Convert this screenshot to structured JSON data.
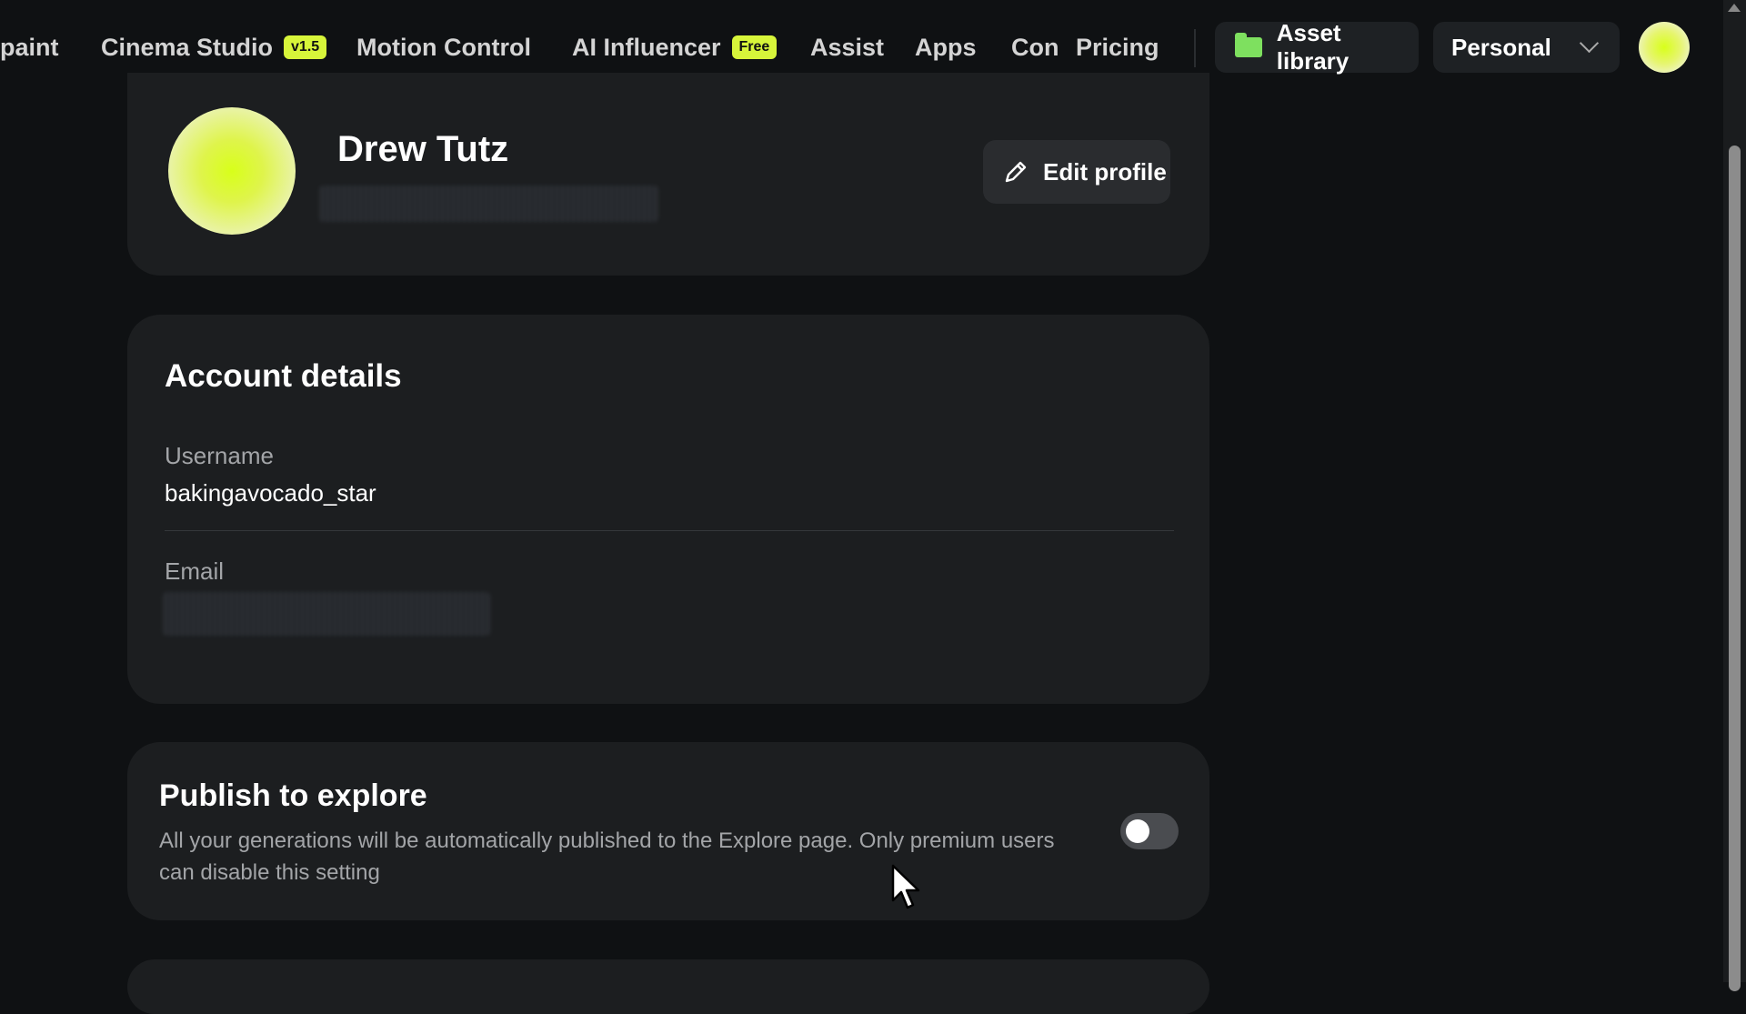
{
  "nav": {
    "items": [
      {
        "label": "paint"
      },
      {
        "label": "Cinema Studio",
        "badge": "v1.5"
      },
      {
        "label": "Motion Control"
      },
      {
        "label": "AI Influencer",
        "badge": "Free"
      },
      {
        "label": "Assist"
      },
      {
        "label": "Apps"
      },
      {
        "label": "Con"
      },
      {
        "label": "Pricing"
      }
    ],
    "asset_library": "Asset library",
    "workspace": "Personal"
  },
  "profile": {
    "name": "Drew Tutz",
    "edit_label": "Edit profile"
  },
  "account": {
    "title": "Account details",
    "username_label": "Username",
    "username": "bakingavocado_star",
    "email_label": "Email"
  },
  "publish": {
    "title": "Publish to explore",
    "description": "All your generations will be automatically published to the Explore page. Only premium users can disable this setting",
    "enabled": false
  },
  "colors": {
    "accent": "#d7f53a",
    "background": "#0f1113",
    "card": "#1c1e20"
  }
}
